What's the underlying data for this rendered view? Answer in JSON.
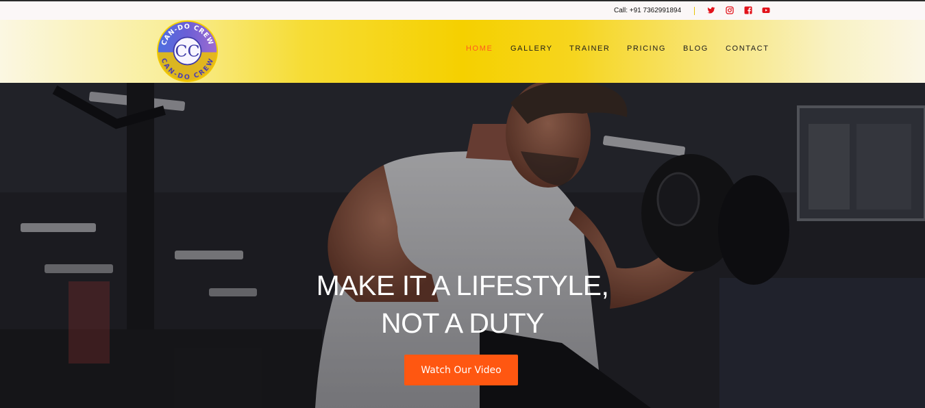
{
  "topbar": {
    "call_text": "Call: +91 7362991894",
    "social_icons": [
      "twitter-icon",
      "instagram-icon",
      "facebook-icon",
      "youtube-icon"
    ],
    "social_color": "#e2131b"
  },
  "brand": {
    "logo_text": "CAN-DO CREW",
    "logo_monogram": "CC"
  },
  "nav": {
    "items": [
      {
        "label": "HOME",
        "active": true
      },
      {
        "label": "GALLERY",
        "active": false
      },
      {
        "label": "TRAINER",
        "active": false
      },
      {
        "label": "PRICING",
        "active": false
      },
      {
        "label": "BLOG",
        "active": false
      },
      {
        "label": "CONTACT",
        "active": false
      }
    ],
    "active_color": "#ff5a1f"
  },
  "hero": {
    "headline_line1": "MAKE IT A LIFESTYLE,",
    "headline_line2": "NOT A DUTY",
    "cta_label": "Watch Our Video",
    "cta_color": "#ff5711"
  },
  "colors": {
    "header_yellow": "#f5d000",
    "accent_orange": "#ff5711"
  }
}
